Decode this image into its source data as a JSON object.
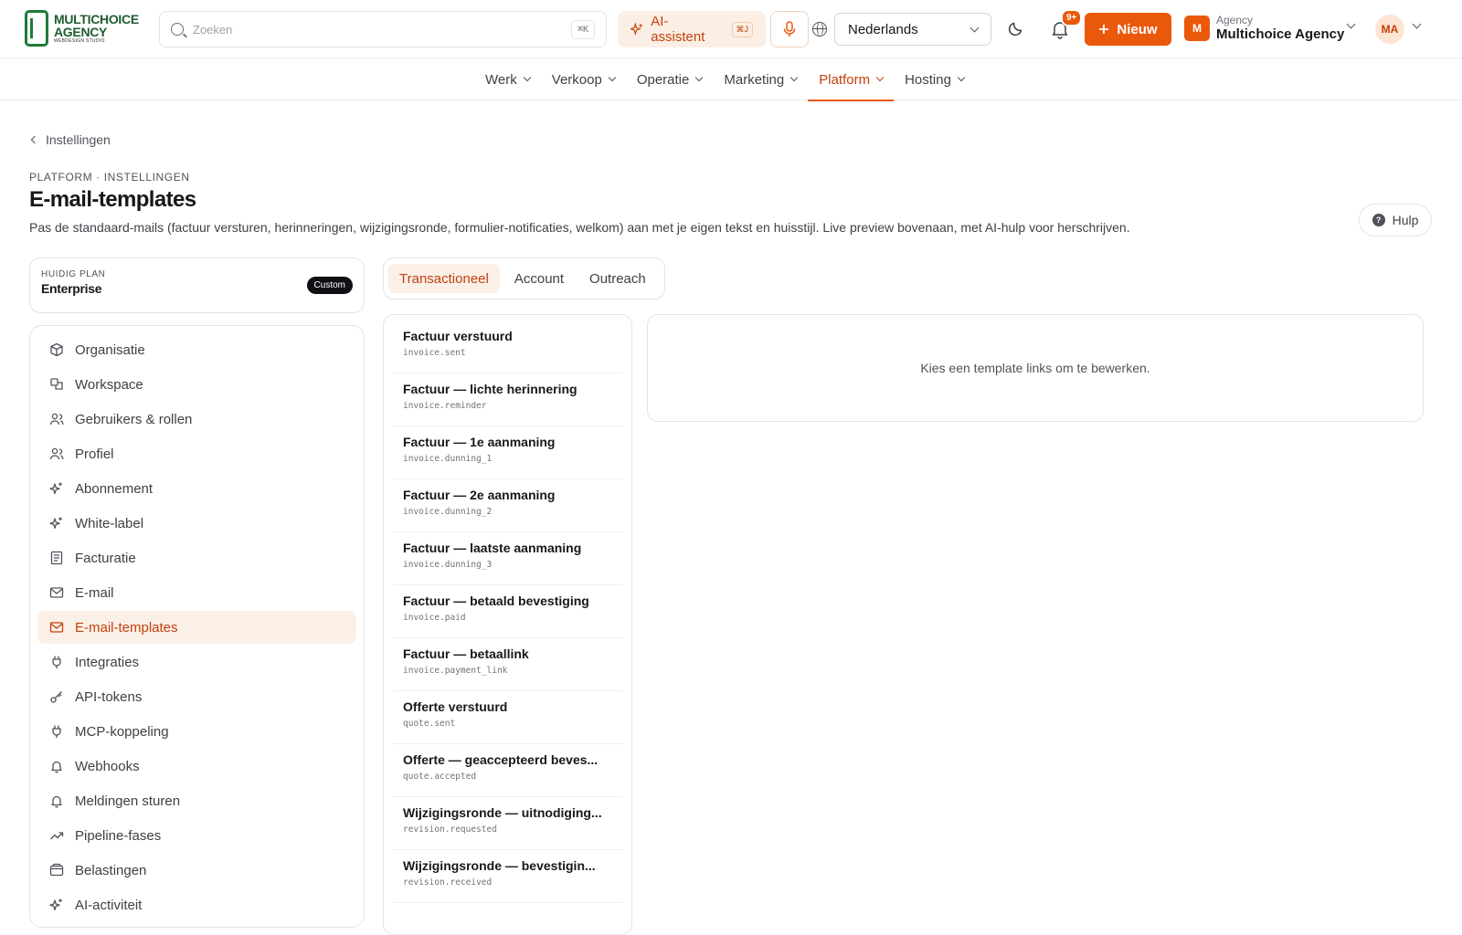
{
  "header": {
    "logo_line1": "MULTICHOICE",
    "logo_line2": "AGENCY",
    "logo_tagline": "WEBDESIGN STUDIO",
    "search_placeholder": "Zoeken",
    "search_shortcut": "⌘K",
    "ai_label": "AI-assistent",
    "ai_shortcut": "⌘J",
    "language": "Nederlands",
    "notification_badge": "9+",
    "new_label": "Nieuw",
    "org_initial": "M",
    "org_type": "Agency",
    "org_name": "Multichoice Agency",
    "user_initials": "MA"
  },
  "nav": {
    "items": [
      {
        "label": "Werk"
      },
      {
        "label": "Verkoop"
      },
      {
        "label": "Operatie"
      },
      {
        "label": "Marketing"
      },
      {
        "label": "Platform",
        "active": true
      },
      {
        "label": "Hosting"
      }
    ]
  },
  "page": {
    "back_label": "Instellingen",
    "eyebrow": "PLATFORM · INSTELLINGEN",
    "title": "E-mail-templates",
    "description": "Pas de standaard-mails (factuur versturen, herinneringen, wijzigingsronde, formulier-notificaties, welkom) aan met je eigen tekst en huisstijl. Live preview bovenaan, met AI-hulp voor herschrijven.",
    "help_label": "Hulp"
  },
  "plan": {
    "label": "HUIDIG PLAN",
    "value": "Enterprise",
    "badge": "Custom"
  },
  "sidebar": {
    "items": [
      {
        "label": "Organisatie",
        "icon": "cube-icon"
      },
      {
        "label": "Workspace",
        "icon": "workspace-icon"
      },
      {
        "label": "Gebruikers & rollen",
        "icon": "users-icon"
      },
      {
        "label": "Profiel",
        "icon": "users-icon"
      },
      {
        "label": "Abonnement",
        "icon": "sparkle-icon"
      },
      {
        "label": "White-label",
        "icon": "sparkle-icon"
      },
      {
        "label": "Facturatie",
        "icon": "document-icon"
      },
      {
        "label": "E-mail",
        "icon": "mail-icon"
      },
      {
        "label": "E-mail-templates",
        "icon": "mail-icon",
        "active": true
      },
      {
        "label": "Integraties",
        "icon": "plug-icon"
      },
      {
        "label": "API-tokens",
        "icon": "key-icon"
      },
      {
        "label": "MCP-koppeling",
        "icon": "plug-icon"
      },
      {
        "label": "Webhooks",
        "icon": "bell-icon"
      },
      {
        "label": "Meldingen sturen",
        "icon": "bell-icon"
      },
      {
        "label": "Pipeline-fases",
        "icon": "trend-icon"
      },
      {
        "label": "Belastingen",
        "icon": "wallet-icon"
      },
      {
        "label": "AI-activiteit",
        "icon": "sparkle-icon"
      }
    ]
  },
  "tabs": [
    {
      "label": "Transactioneel",
      "active": true
    },
    {
      "label": "Account"
    },
    {
      "label": "Outreach"
    }
  ],
  "templates": [
    {
      "name": "Factuur verstuurd",
      "key": "invoice.sent"
    },
    {
      "name": "Factuur — lichte herinnering",
      "key": "invoice.reminder"
    },
    {
      "name": "Factuur — 1e aanmaning",
      "key": "invoice.dunning_1"
    },
    {
      "name": "Factuur — 2e aanmaning",
      "key": "invoice.dunning_2"
    },
    {
      "name": "Factuur — laatste aanmaning",
      "key": "invoice.dunning_3"
    },
    {
      "name": "Factuur — betaald bevestiging",
      "key": "invoice.paid"
    },
    {
      "name": "Factuur — betaallink",
      "key": "invoice.payment_link"
    },
    {
      "name": "Offerte verstuurd",
      "key": "quote.sent"
    },
    {
      "name": "Offerte — geaccepteerd beves...",
      "key": "quote.accepted"
    },
    {
      "name": "Wijzigingsronde — uitnodiging...",
      "key": "revision.requested"
    },
    {
      "name": "Wijzigingsronde — bevestigin...",
      "key": "revision.received"
    }
  ],
  "editor": {
    "empty_message": "Kies een template links om te bewerken."
  },
  "colors": {
    "accent": "#ea580c",
    "accent_text": "#c2410c",
    "accent_bg": "#fbf0e8"
  }
}
